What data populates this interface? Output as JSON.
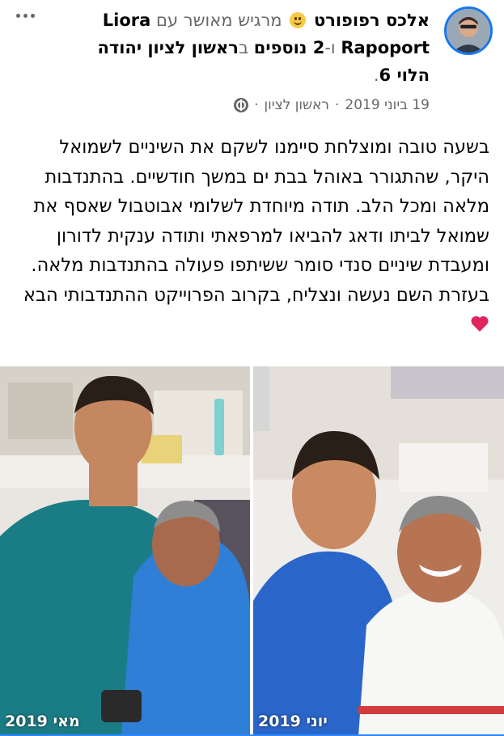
{
  "header": {
    "author": "אלכס רפופורט",
    "feeling_text": "מרגיש מאושר עם",
    "tagged_person": "Liora Rapoport",
    "connector": "ו-",
    "others": "2 נוספים",
    "place_prefix": "ב",
    "place": "ראשון לציון יהודה הלוי 6",
    "period": "."
  },
  "meta": {
    "date": "19 ביוני 2019",
    "separator": "·",
    "location": "ראשון לציון",
    "separator2": "·",
    "privacy_icon": "globe-icon"
  },
  "post": {
    "text": "בשעה טובה ומוצלחת סיימנו לשקם את השיניים לשמואל היקר, שהתגורר באוהל בבת ים במשך חודשיים. בהתנדבות מלאה ומכל הלב. תודה מיוחדת לשלומי אבוטבול שאסף את שמואל לביתו ודאג להביאו למרפאתי ותודה ענקית לדורון ומעבדת שיניים סנדי סומר ששיתפו פעולה בהתנדבות מלאה. בעזרת השם נעשה ונצליח, בקרוב הפרוייקט ההתנדבותי הבא",
    "end_emoji": "heart-icon"
  },
  "photos": [
    {
      "label": "מאי 2019"
    },
    {
      "label": "יוני 2019"
    }
  ],
  "colors": {
    "accent": "#1877f2",
    "muted": "#65676b",
    "heart": "#e0245e"
  }
}
